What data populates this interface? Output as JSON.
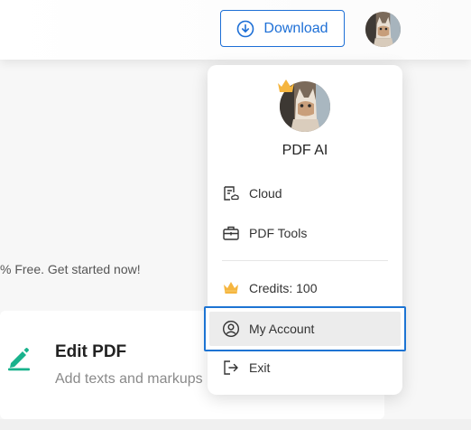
{
  "header": {
    "download_label": "Download"
  },
  "content": {
    "promo_text": "% Free. Get started now!",
    "feature": {
      "title": "Edit PDF",
      "description": "Add texts and markups"
    }
  },
  "menu": {
    "user_name": "PDF AI",
    "items": [
      {
        "label": "Cloud",
        "icon": "cloud-doc-icon"
      },
      {
        "label": "PDF Tools",
        "icon": "toolbox-icon"
      },
      {
        "label": "Credits: 100",
        "icon": "crown-icon"
      },
      {
        "label": "My Account",
        "icon": "user-circle-icon",
        "active": true
      },
      {
        "label": "Exit",
        "icon": "exit-icon"
      }
    ]
  },
  "colors": {
    "accent": "#1d6fd6",
    "feature_icon": "#19b28c",
    "crown": "#f5b53f",
    "active_item_bg": "#ececec"
  }
}
